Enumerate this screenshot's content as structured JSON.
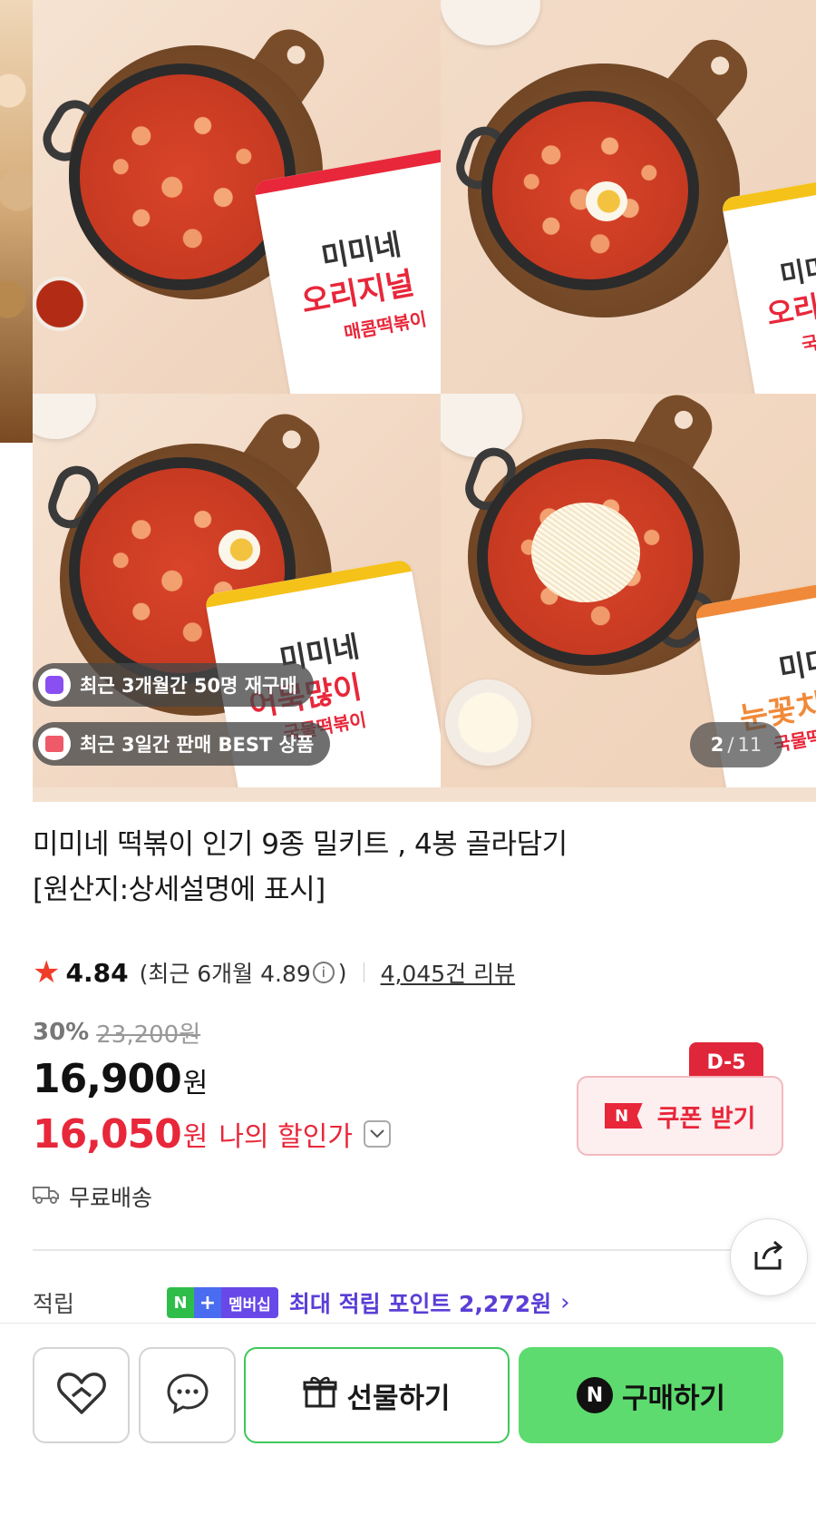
{
  "gallery": {
    "packages": [
      {
        "brand": "미미네",
        "kind": "오리지널",
        "sub": "매콤떡볶이",
        "accent": "#e8273a"
      },
      {
        "brand": "미미네",
        "kind": "오리",
        "sub": "국물",
        "accent": "#f5c21a"
      },
      {
        "brand": "미미네",
        "kind": "어묵많이",
        "sub": "국물떡볶이",
        "accent": "#f5c21a"
      },
      {
        "brand": "미미",
        "kind": "눈꽃치",
        "sub": "국물떡볶",
        "accent": "#f08a3a"
      }
    ],
    "badges": [
      {
        "text": "최근 3개월간 50명 재구매",
        "icon": "repurchase-bag-icon",
        "color": "#8a4ff0"
      },
      {
        "text": "최근 3일간 판매 BEST 상품",
        "icon": "gift-box-icon",
        "color": "#ef5a6a"
      }
    ],
    "counter": {
      "current": "2",
      "separator": "/",
      "total": "11"
    }
  },
  "product": {
    "title_line1": "미미네 떡볶이 인기 9종 밀키트 , 4봉 골라담기",
    "title_line2": "[원산지:상세설명에 표시]",
    "rating": {
      "star_icon": "star-icon",
      "score": "4.84",
      "recent_prefix": "(최근 6개월 4.89",
      "info_glyph": "i",
      "recent_suffix": ")",
      "reviews": "4,045건 리뷰"
    },
    "price": {
      "discount": "30%",
      "original": "23,200원",
      "sale": "16,900",
      "sale_unit": "원",
      "my_price": "16,050",
      "my_unit": "원",
      "my_label": "나의 할인가",
      "dropdown_glyph": "⌄"
    },
    "coupon": {
      "label": "쿠폰 받기",
      "logo": "N",
      "dday": "D-5",
      "color": "#e8273a"
    },
    "shipping": {
      "icon": "truck-icon",
      "label": "무료배송"
    },
    "points": {
      "label": "적립",
      "membership_n": "N",
      "membership_plus": "+",
      "membership_text": "멤버십",
      "text": "최대 적립 포인트 2,272원",
      "chevron": "›"
    }
  },
  "bottom_bar": {
    "like_icon": "heart-icon",
    "talk_icon": "chat-bubble-icon",
    "gift_label": "선물하기",
    "gift_icon": "gift-icon",
    "buy_label": "구매하기",
    "buy_logo": "N",
    "accent": "#5ddb6e"
  }
}
